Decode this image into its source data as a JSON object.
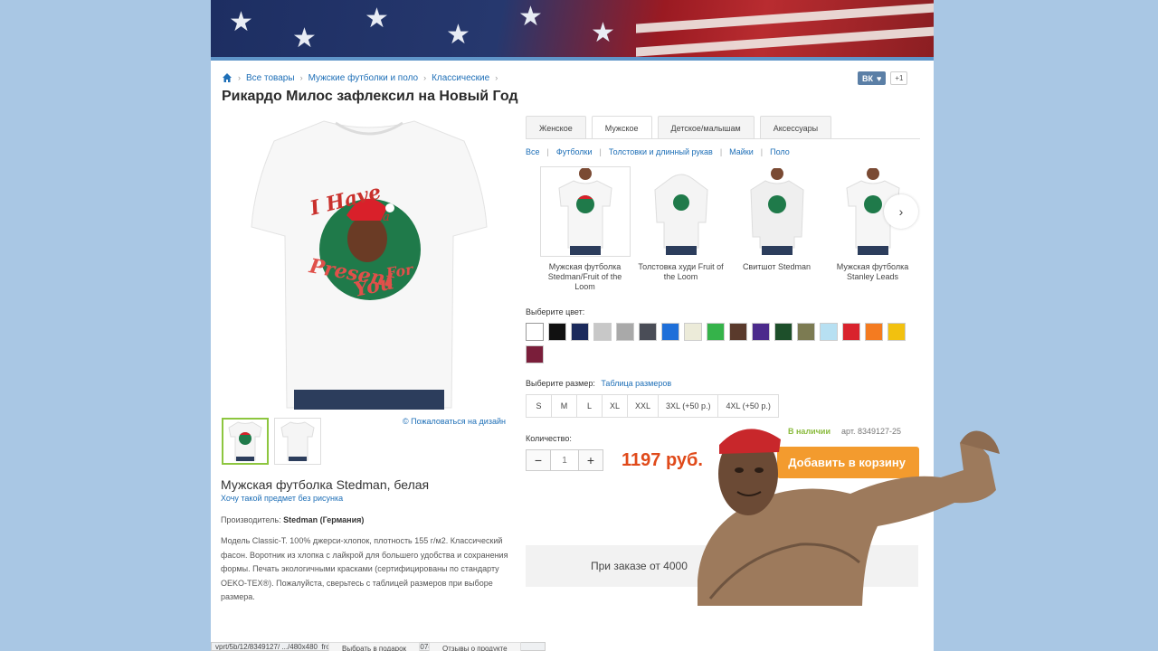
{
  "breadcrumb": {
    "items": [
      "Все товары",
      "Мужские футболки и поло",
      "Классические"
    ]
  },
  "social": {
    "vk": "ВК",
    "plus": "+1"
  },
  "product": {
    "title": "Рикардо Милос зафлексил на Новый Год",
    "print_text": "I Have a Present For You",
    "item_name": "Мужская футболка Stedman, белая",
    "no_print_link": "Хочу такой предмет без рисунка",
    "producer_label": "Производитель:",
    "producer": "Stedman (Германия)",
    "description": "Модель Classic-T. 100% джерси-хлопок, плотность 155 г/м2. Классический фасон. Воротник из хлопка с лайкрой для большего удобства и сохранения формы. Печать экологичными красками (сертифицированы по стандарту OEKO-TEX®). Пожалуйста, сверьтесь с таблицей размеров при выборе размера.",
    "complain": "© Пожаловаться на дизайн"
  },
  "tabs": [
    "Женское",
    "Мужское",
    "Детское/малышам",
    "Аксессуары"
  ],
  "active_tab": 1,
  "subnav": [
    "Все",
    "Футболки",
    "Толстовки и длинный рукав",
    "Майки",
    "Поло"
  ],
  "variants": [
    {
      "label": "Мужская футболка Stedman/Fruit of the Loom",
      "type": "tshirt"
    },
    {
      "label": "Толстовка худи Fruit of the Loom",
      "type": "hoodie"
    },
    {
      "label": "Свитшот Stedman",
      "type": "sweatshirt"
    },
    {
      "label": "Мужская футболка Stanley Leads",
      "type": "tshirt"
    }
  ],
  "color_label": "Выберите цвет:",
  "colors": [
    "#ffffff",
    "#111111",
    "#1b2a5c",
    "#c8c8c8",
    "#a9a9a9",
    "#4a4d57",
    "#1e6fd9",
    "#ecebd9",
    "#35b34a",
    "#5a3a2c",
    "#4b2a8c",
    "#1d4f2a",
    "#7c7b52",
    "#b7e0f2",
    "#d9232d",
    "#f47b20",
    "#f2c10f",
    "#7a1e3a"
  ],
  "size_label": "Выберите размер:",
  "size_table_link": "Таблица размеров",
  "sizes": [
    "S",
    "M",
    "L",
    "XL",
    "XXL",
    "3XL (+50 р.)",
    "4XL (+50 р.)"
  ],
  "quantity_label": "Количество:",
  "quantity": "1",
  "qty_minus": "−",
  "qty_plus": "+",
  "price": "1197 руб.",
  "stock": "В наличии",
  "article": "арт. 8349127-25",
  "cart_button": "Добавить в корзину",
  "promo": "При заказе от 4000",
  "bottom_tabs": [
    "Выбрать в подарок",
    "Отзывы о продукте"
  ],
  "status_url": "vprt/5b/12/8349127/ .../480x480_front_37_0_0_0_c219489e77307e769b61158f2bb1.jpg"
}
